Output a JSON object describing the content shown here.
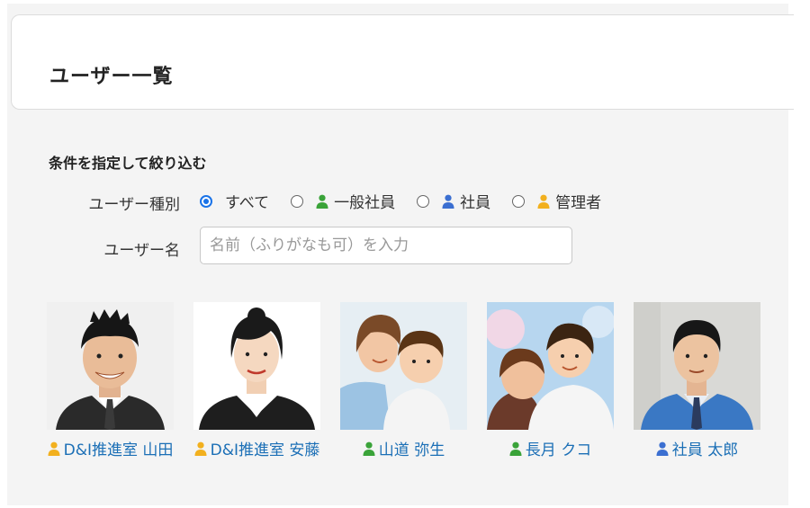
{
  "header": {
    "title": "ユーザー一覧"
  },
  "filter": {
    "heading": "条件を指定して絞り込む",
    "type_label": "ユーザー種別",
    "types": [
      {
        "label": "すべて",
        "checked": true,
        "icon": null
      },
      {
        "label": "一般社員",
        "checked": false,
        "icon": "person-icon",
        "icon_color": "#3aa339"
      },
      {
        "label": "社員",
        "checked": false,
        "icon": "person-icon",
        "icon_color": "#3b6fd1"
      },
      {
        "label": "管理者",
        "checked": false,
        "icon": "person-icon",
        "icon_color": "#f2b01e"
      }
    ],
    "name_label": "ユーザー名",
    "name_placeholder": "名前（ふりがなも可）を入力",
    "name_value": ""
  },
  "users": [
    {
      "name": "D&I推進室 山田",
      "role_color": "#f2b01e",
      "photo": "man-in-suit-smiling"
    },
    {
      "name": "D&I推進室 安藤",
      "role_color": "#f2b01e",
      "photo": "woman-in-suit"
    },
    {
      "name": "山道 弥生",
      "role_color": "#3aa339",
      "photo": "mother-and-child"
    },
    {
      "name": "長月 クコ",
      "role_color": "#3aa339",
      "photo": "mother-and-child-hug"
    },
    {
      "name": "社員 太郎",
      "role_color": "#3b6fd1",
      "photo": "man-in-work-jacket"
    }
  ]
}
